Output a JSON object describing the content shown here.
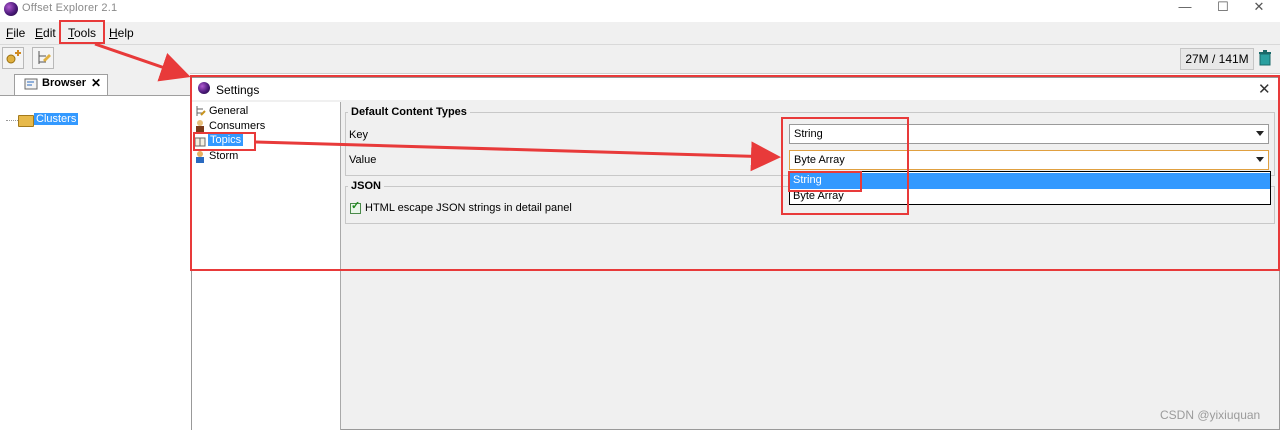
{
  "app": {
    "title": "Offset Explorer  2.1"
  },
  "window_controls": {
    "minimize": "—",
    "maximize": "☐",
    "close": "✕"
  },
  "menu": [
    {
      "label": "File",
      "mnemonic": "F"
    },
    {
      "label": "Edit",
      "mnemonic": "E"
    },
    {
      "label": "Tools",
      "mnemonic": "T"
    },
    {
      "label": "Help",
      "mnemonic": "H"
    }
  ],
  "toolbar": {
    "memory": "27M / 141M"
  },
  "browser": {
    "tab_label": "Browser",
    "tab_close": "✕",
    "tree": {
      "root": "Clusters"
    }
  },
  "settings": {
    "title": "Settings",
    "close": "✕",
    "nav": [
      {
        "label": "General",
        "icon": "general-icon"
      },
      {
        "label": "Consumers",
        "icon": "consumers-icon"
      },
      {
        "label": "Topics",
        "icon": "topics-icon",
        "selected": true
      },
      {
        "label": "Storm",
        "icon": "storm-icon"
      }
    ],
    "default_content_types": {
      "title": "Default Content Types",
      "key_label": "Key",
      "key_value": "String",
      "value_label": "Value",
      "value_value": "Byte Array",
      "options": [
        "String",
        "Byte Array"
      ],
      "highlighted_option": "String"
    },
    "json": {
      "title": "JSON",
      "escape_label": "HTML escape JSON strings in detail panel",
      "escape_checked": true
    }
  },
  "watermark": "CSDN @yixiuquan",
  "colors": {
    "selection": "#3399ff",
    "annotation": "#e83a3a"
  }
}
